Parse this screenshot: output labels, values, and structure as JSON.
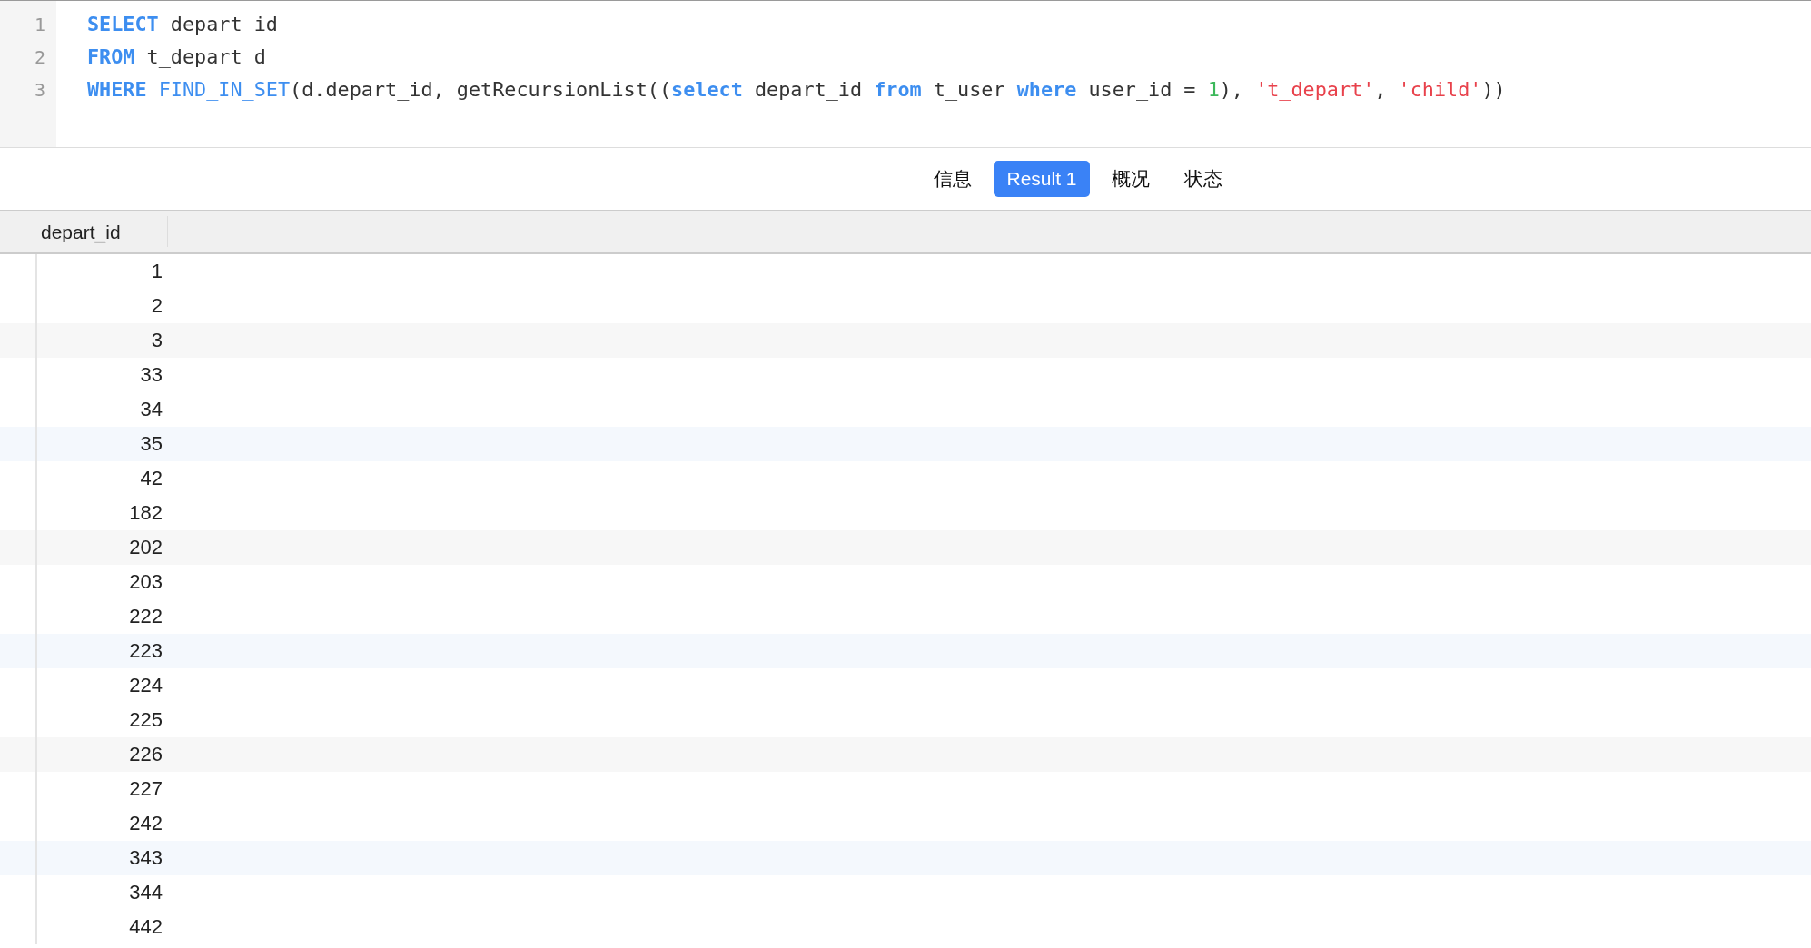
{
  "editor": {
    "lines": [
      {
        "number": "1",
        "tokens": [
          {
            "kind": "keyword",
            "text": "SELECT"
          },
          {
            "kind": "plain",
            "text": " depart_id"
          }
        ]
      },
      {
        "number": "2",
        "tokens": [
          {
            "kind": "keyword",
            "text": "FROM"
          },
          {
            "kind": "plain",
            "text": " t_depart d"
          }
        ]
      },
      {
        "number": "3",
        "tokens": [
          {
            "kind": "keyword",
            "text": "WHERE"
          },
          {
            "kind": "function",
            "text": " FIND_IN_SET"
          },
          {
            "kind": "plain",
            "text": "(d.depart_id, getRecursionList(("
          },
          {
            "kind": "keyword",
            "text": "select"
          },
          {
            "kind": "plain",
            "text": " depart_id "
          },
          {
            "kind": "keyword",
            "text": "from"
          },
          {
            "kind": "plain",
            "text": " t_user "
          },
          {
            "kind": "keyword",
            "text": "where"
          },
          {
            "kind": "plain",
            "text": " user_id = "
          },
          {
            "kind": "number",
            "text": "1"
          },
          {
            "kind": "plain",
            "text": "), "
          },
          {
            "kind": "string",
            "text": "'t_depart'"
          },
          {
            "kind": "plain",
            "text": ", "
          },
          {
            "kind": "string",
            "text": "'child'"
          },
          {
            "kind": "plain",
            "text": "))"
          }
        ]
      }
    ]
  },
  "tabs": [
    {
      "label": "信息",
      "selected": false
    },
    {
      "label": "Result 1",
      "selected": true
    },
    {
      "label": "概况",
      "selected": false
    },
    {
      "label": "状态",
      "selected": false
    }
  ],
  "table": {
    "columns": [
      "depart_id"
    ],
    "rows": [
      "1",
      "2",
      "3",
      "33",
      "34",
      "35",
      "42",
      "182",
      "202",
      "203",
      "222",
      "223",
      "224",
      "225",
      "226",
      "227",
      "242",
      "343",
      "344",
      "442"
    ]
  }
}
